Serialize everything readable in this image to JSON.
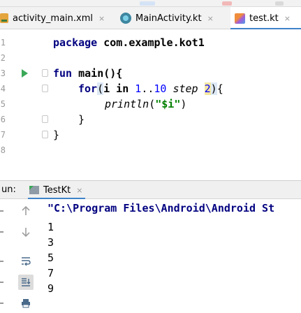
{
  "tabs": [
    {
      "label": "activity_main.xml",
      "icon": "xml-file-icon",
      "active": false
    },
    {
      "label": "MainActivity.kt",
      "icon": "kotlin-class-icon",
      "active": false
    },
    {
      "label": "test.kt",
      "icon": "kotlin-file-icon",
      "active": true
    }
  ],
  "tab_close_glyph": "×",
  "editor": {
    "line_numbers": [
      "1",
      "2",
      "3",
      "4",
      "5",
      "6",
      "7",
      "8"
    ],
    "code_tokens": {
      "package_kw": "package",
      "package_name": " com.example.kot1",
      "fun_kw": "fun",
      "main_sig": " main(){",
      "for_kw": "for",
      "for_open": "(",
      "i_in": "i in ",
      "range_start": "1",
      "range_op": "..",
      "range_end": "10",
      "step_kw": " step ",
      "step_val": "2",
      "for_close": ")",
      "for_brace": "{",
      "println_fn": "println",
      "println_open": "(",
      "println_str": "\"$i\"",
      "println_close": ")",
      "close_brace_inner": "}",
      "close_brace_outer": "}"
    }
  },
  "run_panel": {
    "label": "un:",
    "tab_label": "TestKt",
    "command": "\"C:\\Program Files\\Android\\Android St",
    "output": [
      "1",
      "3",
      "5",
      "7",
      "9"
    ]
  },
  "colors": {
    "keyword": "#000080",
    "number": "#0000ff",
    "string": "#008000",
    "accent": "#4083c9",
    "run": "#3aa857"
  }
}
